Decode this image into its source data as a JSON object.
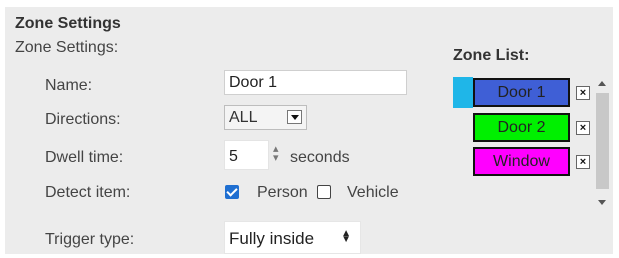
{
  "header": {
    "title": "Zone Settings"
  },
  "form": {
    "subtitle": "Zone Settings:",
    "name": {
      "label": "Name:",
      "value": "Door 1"
    },
    "directions": {
      "label": "Directions:",
      "value": "ALL"
    },
    "dwell": {
      "label": "Dwell time:",
      "value": "5",
      "unit": "seconds"
    },
    "detect": {
      "label": "Detect item:",
      "person": "Person",
      "person_checked": true,
      "vehicle": "Vehicle",
      "vehicle_checked": false
    },
    "trigger": {
      "label": "Trigger type:",
      "value": "Fully inside"
    }
  },
  "zone_list": {
    "label": "Zone List:",
    "delete_label": "×",
    "items": [
      {
        "name": "Door 1",
        "color": "#3f5fd6",
        "selected": true
      },
      {
        "name": "Door 2",
        "color": "#00f000",
        "selected": false
      },
      {
        "name": "Window",
        "color": "#ff00ff",
        "selected": false
      }
    ]
  },
  "colors": {
    "panel_bg": "#ececec",
    "selection_accent": "#1fb6e8",
    "checkbox_accent": "#1f6fd1"
  }
}
